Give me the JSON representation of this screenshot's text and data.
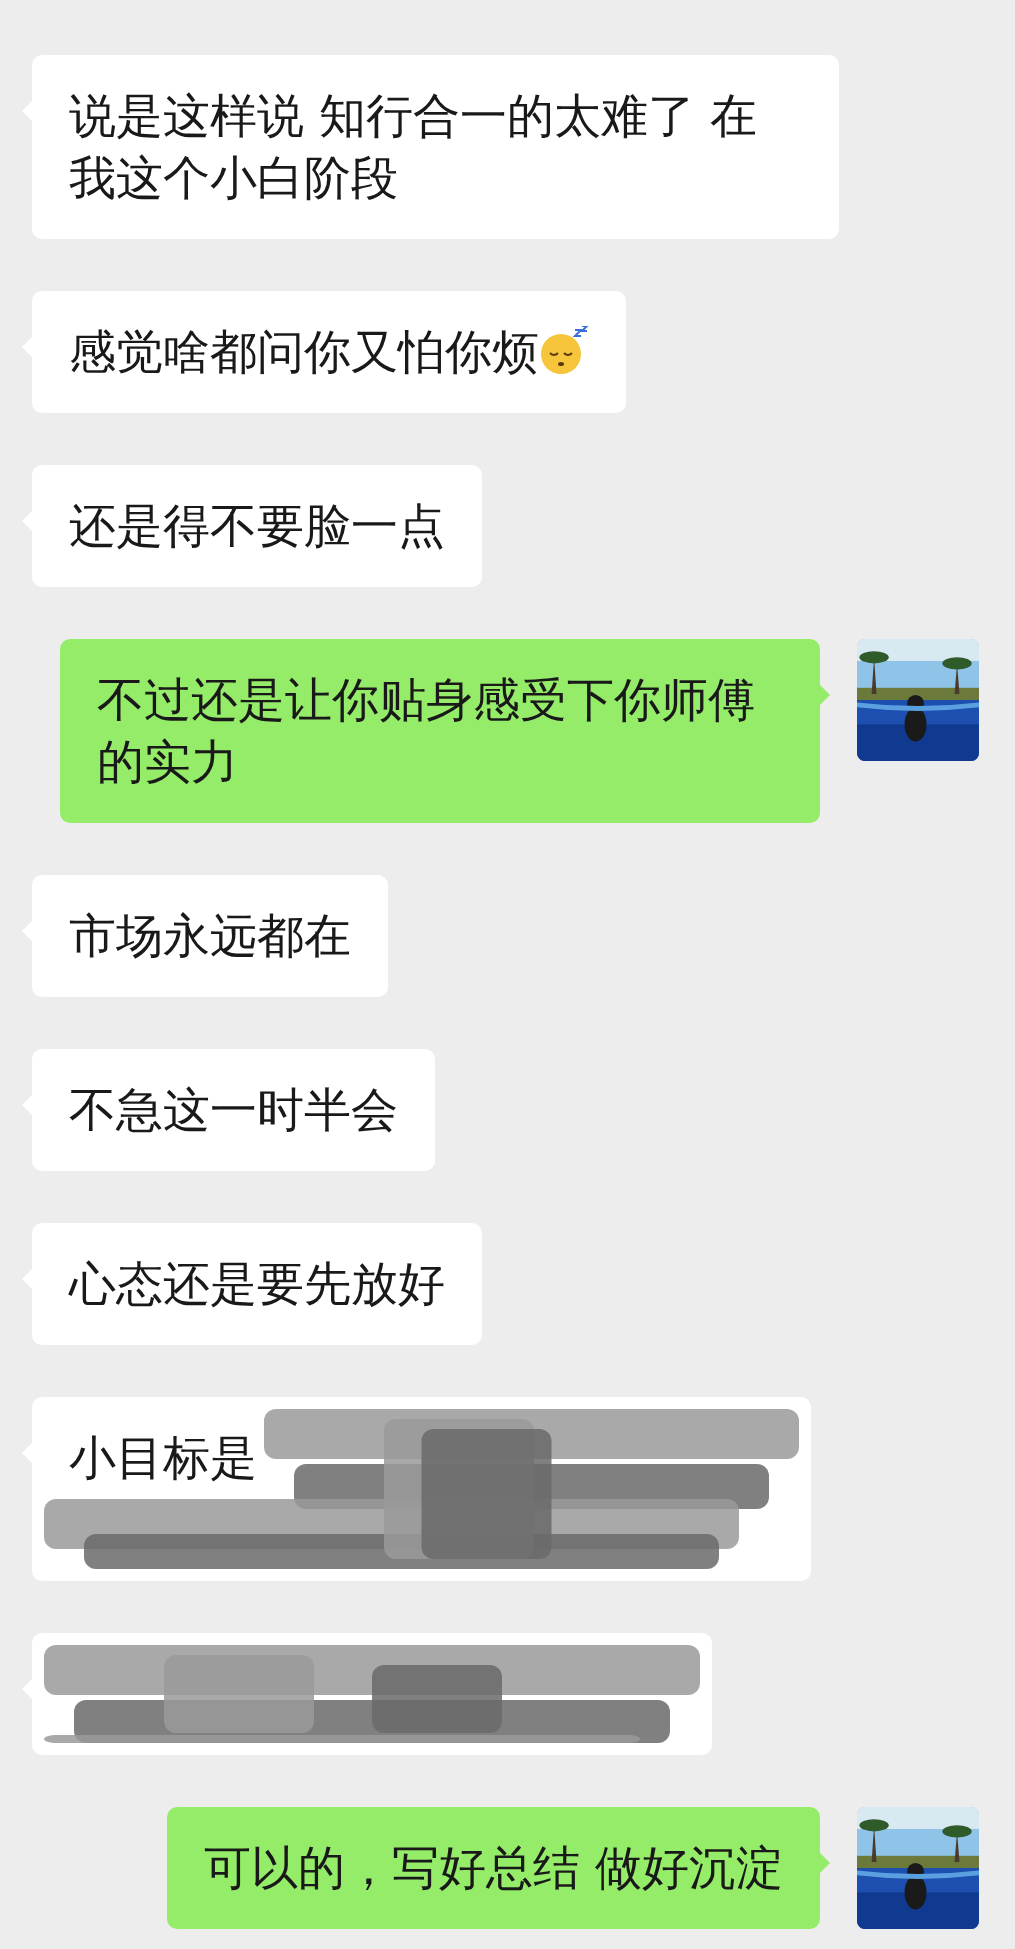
{
  "messages": [
    {
      "outgoing": false,
      "kind": "text",
      "text": "说是这样说 知行合一的太难了 在我这个小白阶段"
    },
    {
      "outgoing": false,
      "kind": "text",
      "text": "感觉啥都问你又怕你烦",
      "emoji": true
    },
    {
      "outgoing": false,
      "kind": "text",
      "text": "还是得不要脸一点"
    },
    {
      "outgoing": true,
      "kind": "text",
      "text": "不过还是让你贴身感受下你师傅的实力"
    },
    {
      "outgoing": false,
      "kind": "text",
      "text": "市场永远都在"
    },
    {
      "outgoing": false,
      "kind": "text",
      "text": "不急这一时半会"
    },
    {
      "outgoing": false,
      "kind": "text",
      "text": "心态还是要先放好"
    },
    {
      "outgoing": false,
      "kind": "partly_redacted",
      "text": "小目标是"
    },
    {
      "outgoing": false,
      "kind": "redacted"
    },
    {
      "outgoing": true,
      "kind": "text",
      "text": "可以的，写好总结 做好沉淀"
    }
  ]
}
